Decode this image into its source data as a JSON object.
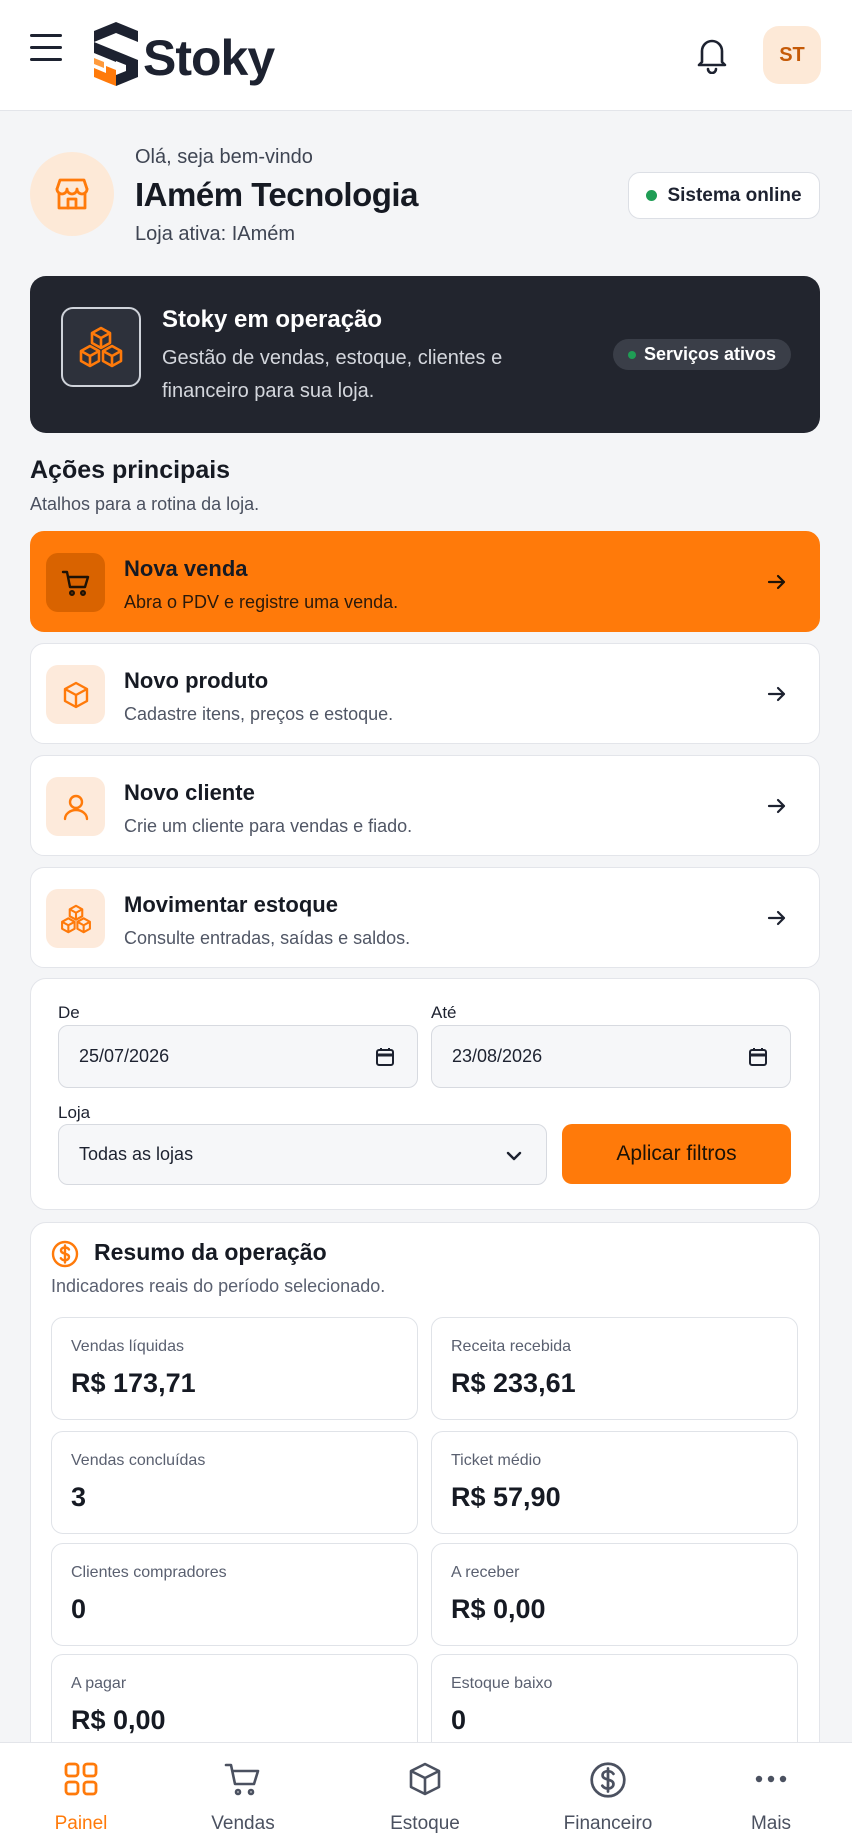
{
  "header": {
    "brand": "Stoky",
    "avatar_initials": "ST"
  },
  "welcome": {
    "greeting": "Olá, seja bem-vindo",
    "company": "IAmém Tecnologia",
    "active_store": "Loja ativa: IAmém",
    "status": "Sistema online"
  },
  "banner": {
    "title": "Stoky em operação",
    "description": "Gestão de vendas, estoque, clientes e financeiro para sua loja.",
    "services": "Serviços ativos"
  },
  "actions_section": {
    "title": "Ações principais",
    "subtitle": "Atalhos para a rotina da loja."
  },
  "actions": [
    {
      "title": "Nova venda",
      "desc": "Abra o PDV e registre uma venda.",
      "icon": "cart-icon"
    },
    {
      "title": "Novo produto",
      "desc": "Cadastre itens, preços e estoque.",
      "icon": "box-icon"
    },
    {
      "title": "Novo cliente",
      "desc": "Crie um cliente para vendas e fiado.",
      "icon": "user-icon"
    },
    {
      "title": "Movimentar estoque",
      "desc": "Consulte entradas, saídas e saldos.",
      "icon": "boxes-icon"
    }
  ],
  "filters": {
    "from_label": "De",
    "from_value": "25/07/2026",
    "to_label": "Até",
    "to_value": "23/08/2026",
    "store_label": "Loja",
    "store_value": "Todas as lojas",
    "apply": "Aplicar filtros"
  },
  "summary": {
    "title": "Resumo da operação",
    "subtitle": "Indicadores reais do período selecionado.",
    "metrics": [
      {
        "label": "Vendas líquidas",
        "value": "R$ 173,71"
      },
      {
        "label": "Receita recebida",
        "value": "R$ 233,61"
      },
      {
        "label": "Vendas concluídas",
        "value": "3"
      },
      {
        "label": "Ticket médio",
        "value": "R$ 57,90"
      },
      {
        "label": "Clientes compradores",
        "value": "0"
      },
      {
        "label": "A receber",
        "value": "R$ 0,00"
      },
      {
        "label": "A pagar",
        "value": "R$ 0,00"
      },
      {
        "label": "Estoque baixo",
        "value": "0"
      }
    ]
  },
  "nav": [
    {
      "label": "Painel",
      "icon": "grid-icon",
      "active": true
    },
    {
      "label": "Vendas",
      "icon": "cart-icon"
    },
    {
      "label": "Estoque",
      "icon": "box-icon"
    },
    {
      "label": "Financeiro",
      "icon": "dollar-icon"
    },
    {
      "label": "Mais",
      "icon": "more-icon"
    }
  ],
  "colors": {
    "accent": "#ff7a0a",
    "dark": "#22252e",
    "online": "#1f9d55"
  }
}
